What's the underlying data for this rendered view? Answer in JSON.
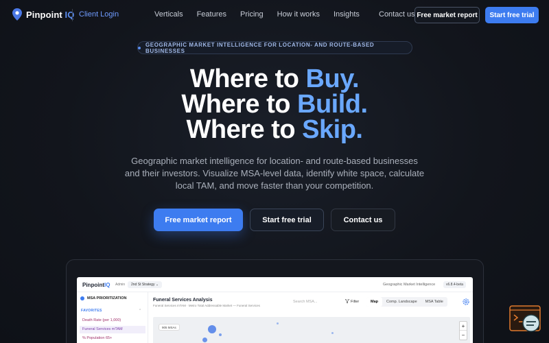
{
  "nav": {
    "brand_main": "Pinpoint ",
    "brand_accent": "IQ",
    "client_login": "Client Login",
    "links": [
      "Verticals",
      "Features",
      "Pricing",
      "How it works",
      "Insights"
    ],
    "contact": "Contact us",
    "free_report": "Free market report",
    "start_trial": "Start free trial"
  },
  "hero": {
    "badge": "GEOGRAPHIC MARKET INTELLIGENCE FOR LOCATION- AND ROUTE-BASED BUSINESSES",
    "lines": [
      {
        "prefix": "Where to ",
        "accent": "Buy."
      },
      {
        "prefix": "Where to ",
        "accent": "Build."
      },
      {
        "prefix": "Where to ",
        "accent": "Skip."
      }
    ],
    "subtext": "Geographic market intelligence for location- and route-based businesses and their investors. Visualize MSA-level data, identify white space, calculate local TAM, and move faster than your competition.",
    "cta_primary": "Free market report",
    "cta_secondary": "Start free trial",
    "cta_tertiary": "Contact us"
  },
  "preview": {
    "logo_main": "Pinpoint",
    "logo_accent": "IQ",
    "admin": "Admin",
    "strategy": "2nd St Strategy  ⌄",
    "gmi": "Geographic Market Intelligence",
    "version": "v6.8.4-beta",
    "msa_prioritization": "MSA PRIORITIZATION",
    "favorites": "FAVORITES",
    "favorites_chevron": "⌃",
    "side_items": [
      "Death Rate (per 1,000)",
      "Funeral Services mTAM",
      "% Population 65+"
    ],
    "title": "Funeral Services Analysis",
    "subtitle": "Funeral Services mTAM · Metro Total Addressable Market — Funeral Services",
    "search_placeholder": "Search MSA...",
    "filter": "Filter",
    "tabs": [
      "Map",
      "Comp. Landscape",
      "MSA Table"
    ],
    "msa_count": "905 MSAs",
    "zoom_in": "+",
    "zoom_out": "−"
  },
  "colors": {
    "accent": "#3d7cf0",
    "headline_accent": "#6aa8ff",
    "background": "#12151c"
  }
}
